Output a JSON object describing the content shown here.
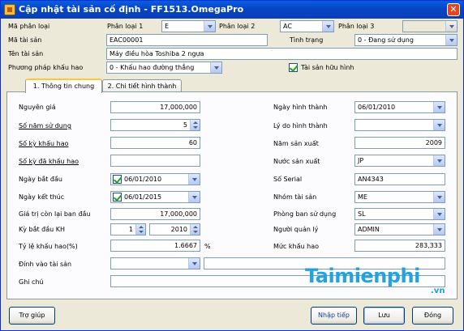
{
  "window": {
    "title": "Cập nhật tài sản cố định - FF1513.OmegaPro",
    "close_glyph": "✕"
  },
  "header": {
    "ma_phan_loai": "Mã phân loại",
    "phan_loai_1_label": "Phân loại 1",
    "phan_loai_1_value": "E",
    "phan_loai_2_label": "Phân loại 2",
    "phan_loai_2_value": "AC",
    "phan_loai_3_label": "Phân loại 3",
    "phan_loai_3_value": "",
    "ma_tai_san_label": "Mã tài sản",
    "ma_tai_san_value": "EAC00001",
    "tinh_trang_label": "Tình trạng",
    "tinh_trang_value": "0 - Đang sử dụng",
    "ten_tai_san_label": "Tên tài sản",
    "ten_tai_san_value": "Máy điều hòa Toshiba 2 ngựa",
    "phuong_phap_label": "Phương pháp khấu hao",
    "phuong_phap_value": "0 - Khấu hao đường thẳng",
    "tai_san_huu_hinh_label": "Tài sản hữu hình",
    "tai_san_huu_hinh_checked": true
  },
  "tabs": [
    {
      "label": "1. Thông tin chung",
      "active": true
    },
    {
      "label": "2. Chi tiết hình thành",
      "active": false
    }
  ],
  "left": {
    "nguyen_gia_label": "Nguyên giá",
    "nguyen_gia_value": "17,000,000",
    "so_nam_label": "Số năm sử dụng",
    "so_nam_value": "5",
    "so_ky_label": "Số kỳ khấu hao",
    "so_ky_value": "60",
    "so_ky_da_label": "Số kỳ đã khấu hao",
    "so_ky_da_value": "",
    "ngay_bat_dau_label": "Ngày bắt đầu",
    "ngay_bat_dau_value": "06/01/2010",
    "ngay_ket_thuc_label": "Ngày kết thúc",
    "ngay_ket_thuc_value": "06/01/2015",
    "gia_tri_con_lai_label": "Giá trị còn lại ban đầu",
    "gia_tri_con_lai_value": "17,000,000",
    "ky_bat_dau_label": "Kỳ bắt đầu KH",
    "ky_bat_dau_period": "1",
    "ky_bat_dau_year": "2010",
    "ty_le_label": "Tỷ lệ khấu hao(%)",
    "ty_le_value": "1.6667",
    "ty_le_unit": "%",
    "dinh_vao_label": "Đính vào tài sản",
    "dinh_vao_value": "",
    "dinh_vao_desc": "",
    "ghi_chu_label": "Ghi chú",
    "ghi_chu_value": ""
  },
  "right": {
    "ngay_hinh_thanh_label": "Ngày hình thành",
    "ngay_hinh_thanh_value": "06/01/2010",
    "ly_do_label": "Lý do hình thành",
    "ly_do_value": "",
    "nam_san_xuat_label": "Năm sản xuất",
    "nam_san_xuat_value": "2009",
    "nuoc_san_xuat_label": "Nước sản xuất",
    "nuoc_san_xuat_value": "JP",
    "so_serial_label": "Số Serial",
    "so_serial_value": "AN4343",
    "nhom_tai_san_label": "Nhóm tài sản",
    "nhom_tai_san_value": "ME",
    "phong_ban_label": "Phòng ban sử dụng",
    "phong_ban_value": "SL",
    "nguoi_quan_ly_label": "Người quản lý",
    "nguoi_quan_ly_value": "ADMIN",
    "muc_khau_hao_label": "Mức khấu hao",
    "muc_khau_hao_value": "283,333"
  },
  "buttons": {
    "tro_giup": "Trợ giúp",
    "nhap_tiep": "Nhập tiếp",
    "luu": "Lưu",
    "dong": "Đóng"
  },
  "watermark": {
    "logo": "Taimienphi",
    "suffix": ".vn"
  },
  "colors": {
    "title_bar": "#0a5de0",
    "window_bg": "#ece9d8",
    "input_border": "#7f9db9",
    "watermark": "#1aa0da"
  }
}
